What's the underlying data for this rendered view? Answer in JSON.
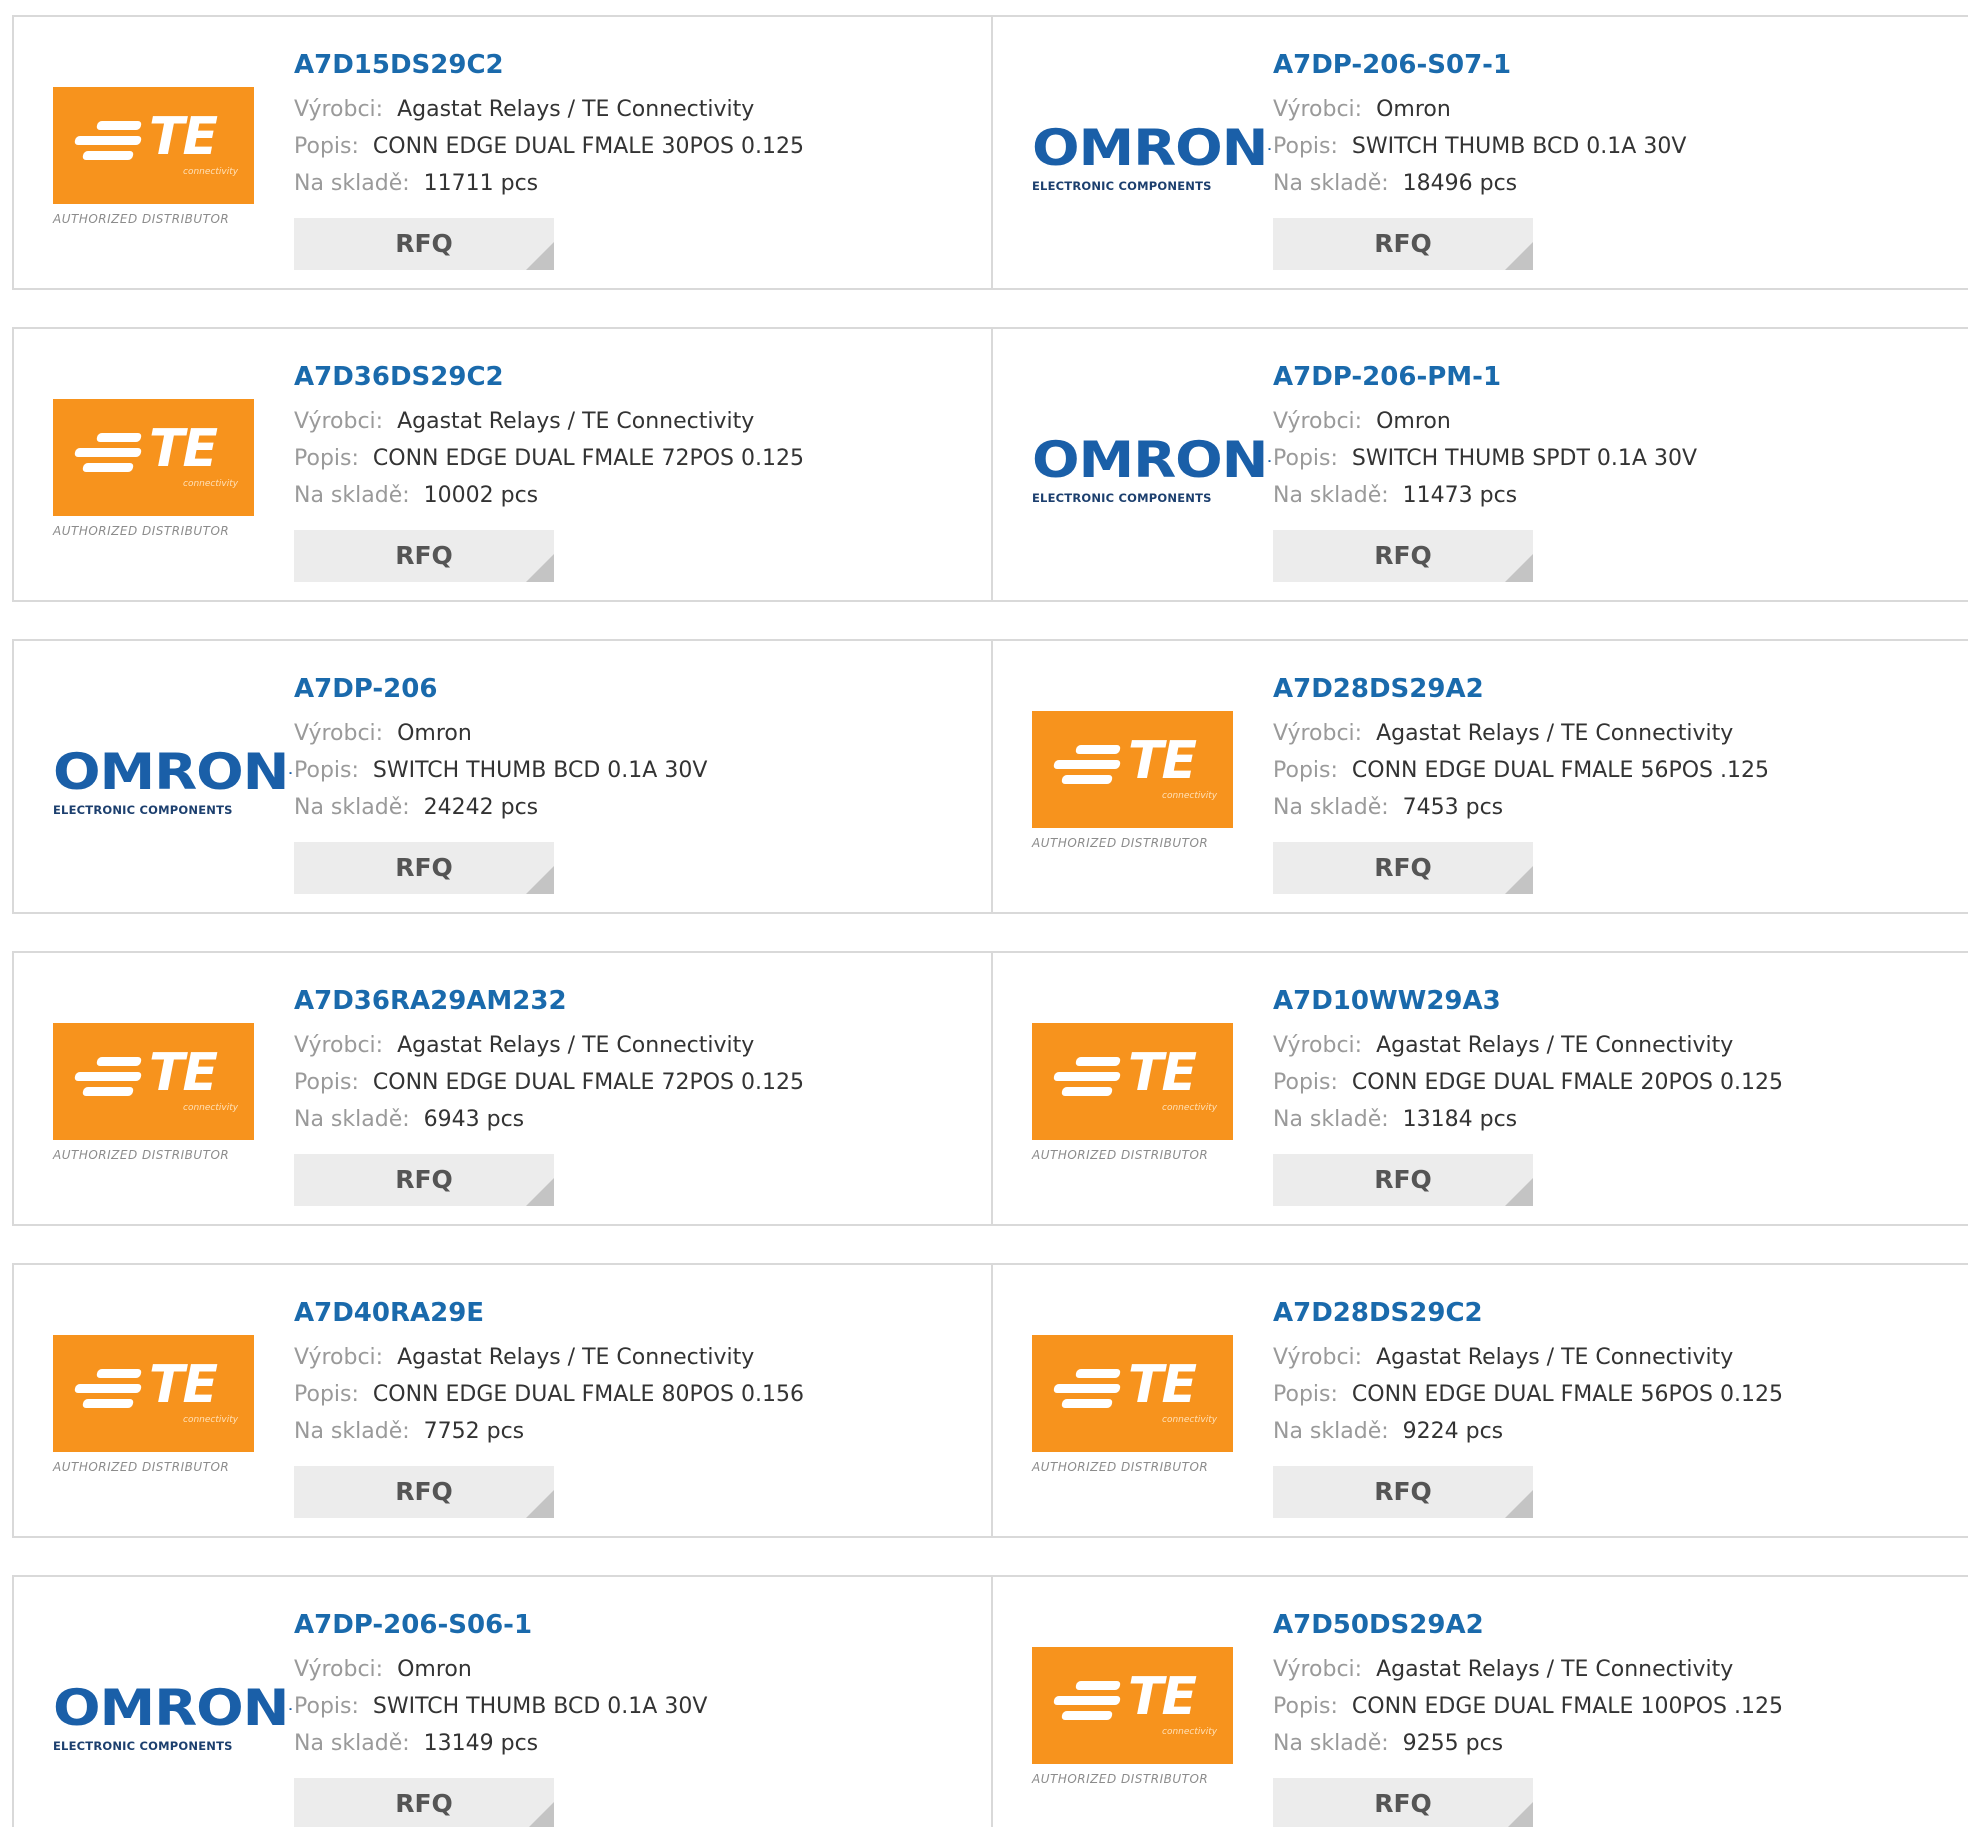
{
  "labels": {
    "manufacturer": "Výrobci:",
    "description": "Popis:",
    "stock": "Na skladě:",
    "rfq": "RFQ"
  },
  "logos": {
    "te": {
      "text": "TE",
      "sub": "connectivity",
      "authorized": "AUTHORIZED DISTRIBUTOR"
    },
    "omron": {
      "text": "OMRON",
      "mark": ".",
      "sub": "ELECTRONIC COMPONENTS"
    }
  },
  "colors": {
    "link": "#1a6aac",
    "te_orange": "#f7931d",
    "omron_blue": "#1a5fa8",
    "rfq_bg": "#ececec",
    "border": "#d9d9d9"
  },
  "products": [
    {
      "part": "A7D15DS29C2",
      "logo": "te",
      "manufacturer": "Agastat Relays / TE Connectivity",
      "description": "CONN EDGE DUAL FMALE 30POS 0.125",
      "stock": "11711 pcs"
    },
    {
      "part": "A7DP-206-S07-1",
      "logo": "omron",
      "manufacturer": "Omron",
      "description": "SWITCH THUMB BCD 0.1A 30V",
      "stock": "18496 pcs"
    },
    {
      "part": "A7D36DS29C2",
      "logo": "te",
      "manufacturer": "Agastat Relays / TE Connectivity",
      "description": "CONN EDGE DUAL FMALE 72POS 0.125",
      "stock": "10002 pcs"
    },
    {
      "part": "A7DP-206-PM-1",
      "logo": "omron",
      "manufacturer": "Omron",
      "description": "SWITCH THUMB SPDT 0.1A 30V",
      "stock": "11473 pcs"
    },
    {
      "part": "A7DP-206",
      "logo": "omron",
      "manufacturer": "Omron",
      "description": "SWITCH THUMB BCD 0.1A 30V",
      "stock": "24242 pcs"
    },
    {
      "part": "A7D28DS29A2",
      "logo": "te",
      "manufacturer": "Agastat Relays / TE Connectivity",
      "description": "CONN EDGE DUAL FMALE 56POS .125",
      "stock": "7453 pcs"
    },
    {
      "part": "A7D36RA29AM232",
      "logo": "te",
      "manufacturer": "Agastat Relays / TE Connectivity",
      "description": "CONN EDGE DUAL FMALE 72POS 0.125",
      "stock": "6943 pcs"
    },
    {
      "part": "A7D10WW29A3",
      "logo": "te",
      "manufacturer": "Agastat Relays / TE Connectivity",
      "description": "CONN EDGE DUAL FMALE 20POS 0.125",
      "stock": "13184 pcs"
    },
    {
      "part": "A7D40RA29E",
      "logo": "te",
      "manufacturer": "Agastat Relays / TE Connectivity",
      "description": "CONN EDGE DUAL FMALE 80POS 0.156",
      "stock": "7752 pcs"
    },
    {
      "part": "A7D28DS29C2",
      "logo": "te",
      "manufacturer": "Agastat Relays / TE Connectivity",
      "description": "CONN EDGE DUAL FMALE 56POS 0.125",
      "stock": "9224 pcs"
    },
    {
      "part": "A7DP-206-S06-1",
      "logo": "omron",
      "manufacturer": "Omron",
      "description": "SWITCH THUMB BCD 0.1A 30V",
      "stock": "13149 pcs"
    },
    {
      "part": "A7D50DS29A2",
      "logo": "te",
      "manufacturer": "Agastat Relays / TE Connectivity",
      "description": "CONN EDGE DUAL FMALE 100POS .125",
      "stock": "9255 pcs"
    }
  ]
}
